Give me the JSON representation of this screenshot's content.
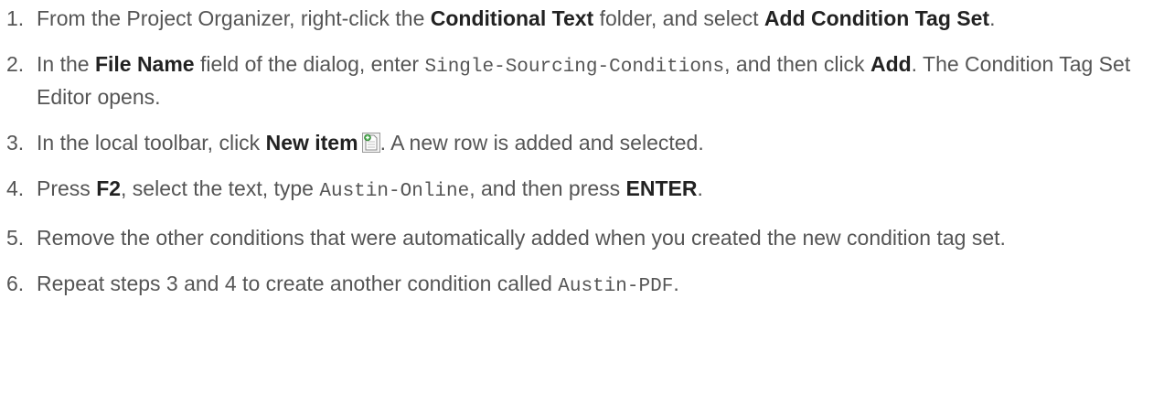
{
  "steps": [
    {
      "number": "1.",
      "parts": [
        {
          "t": "From the Project Organizer, right-click the ",
          "s": "plain"
        },
        {
          "t": "Conditional Text",
          "s": "bold"
        },
        {
          "t": " folder, and select ",
          "s": "plain"
        },
        {
          "t": "Add Condition Tag Set",
          "s": "bold"
        },
        {
          "t": ".",
          "s": "plain"
        }
      ]
    },
    {
      "number": "2.",
      "parts": [
        {
          "t": "In the ",
          "s": "plain"
        },
        {
          "t": "File Name",
          "s": "bold"
        },
        {
          "t": " field of the dialog, enter ",
          "s": "plain"
        },
        {
          "t": "Single-Sourcing-Conditions",
          "s": "code"
        },
        {
          "t": ", and then click ",
          "s": "plain"
        },
        {
          "t": "Add",
          "s": "bold"
        },
        {
          "t": ". The Condition Tag Set Editor opens.",
          "s": "plain"
        }
      ]
    },
    {
      "number": "3.",
      "parts": [
        {
          "t": "In the local toolbar, click ",
          "s": "plain"
        },
        {
          "t": "New item",
          "s": "bold"
        },
        {
          "icon": "new-item-icon"
        },
        {
          "t": ". A new row is added and selected.",
          "s": "plain"
        }
      ]
    },
    {
      "number": "4.",
      "parts": [
        {
          "t": "Press ",
          "s": "plain"
        },
        {
          "t": "F2",
          "s": "bold"
        },
        {
          "t": ", select the text, type ",
          "s": "plain"
        },
        {
          "t": "Austin-Online",
          "s": "code"
        },
        {
          "t": ", and then press ",
          "s": "plain"
        },
        {
          "t": "ENTER",
          "s": "bold"
        },
        {
          "t": ".",
          "s": "plain"
        }
      ]
    },
    {
      "number": "5.",
      "parts": [
        {
          "t": "Remove the other conditions that were automatically added when you created the new condition tag set.",
          "s": "plain"
        }
      ]
    },
    {
      "number": "6.",
      "parts": [
        {
          "t": "Repeat steps 3 and 4 to create another condition called ",
          "s": "plain"
        },
        {
          "t": "Austin-PDF",
          "s": "code"
        },
        {
          "t": ".",
          "s": "plain"
        }
      ]
    }
  ]
}
